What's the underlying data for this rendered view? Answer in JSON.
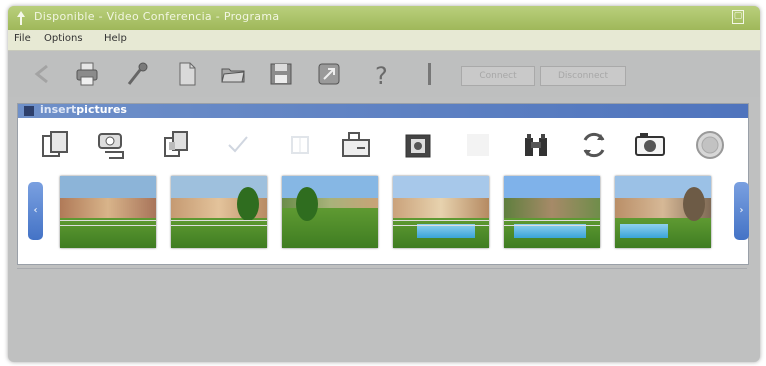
{
  "window": {
    "title": "Disponible - Video Conferencia - Programa"
  },
  "menu": {
    "items": [
      "File",
      "Options",
      "Help"
    ]
  },
  "toolbar": {
    "icons": [
      "back-icon",
      "print-icon",
      "microphone-icon",
      "document-icon",
      "folder-icon",
      "save-icon",
      "clipboard-icon",
      "help-icon"
    ],
    "buttons": [
      "Connect",
      "Disconnect"
    ]
  },
  "panel": {
    "title_prefix": "insert",
    "title_emphasis": "pictures",
    "tools": [
      "copy-pages-icon",
      "camera-link-icon",
      "multi-copy-icon",
      "check-icon",
      "grid-icon",
      "folder-arrow-icon",
      "frame-photo-icon",
      "blank-icon",
      "binoculars-icon",
      "refresh-icon",
      "camera-icon",
      "film-reel-icon"
    ]
  },
  "strip": {
    "prev": "‹",
    "next": "›",
    "thumbnails": [
      {
        "kind": "house",
        "sky": "#8cb4d8"
      },
      {
        "kind": "house-tree",
        "sky": "#9ec0dd"
      },
      {
        "kind": "lawn",
        "sky": "#86b7e4"
      },
      {
        "kind": "pool",
        "sky": "#a7c8ea"
      },
      {
        "kind": "pool",
        "sky": "#7fb2ea"
      },
      {
        "kind": "pool-tree",
        "sky": "#9bc1e6"
      }
    ]
  },
  "colors": {
    "titlebar": "#a9c166",
    "panel_header": "#5a7fc4",
    "nav": "#4a78c9"
  }
}
